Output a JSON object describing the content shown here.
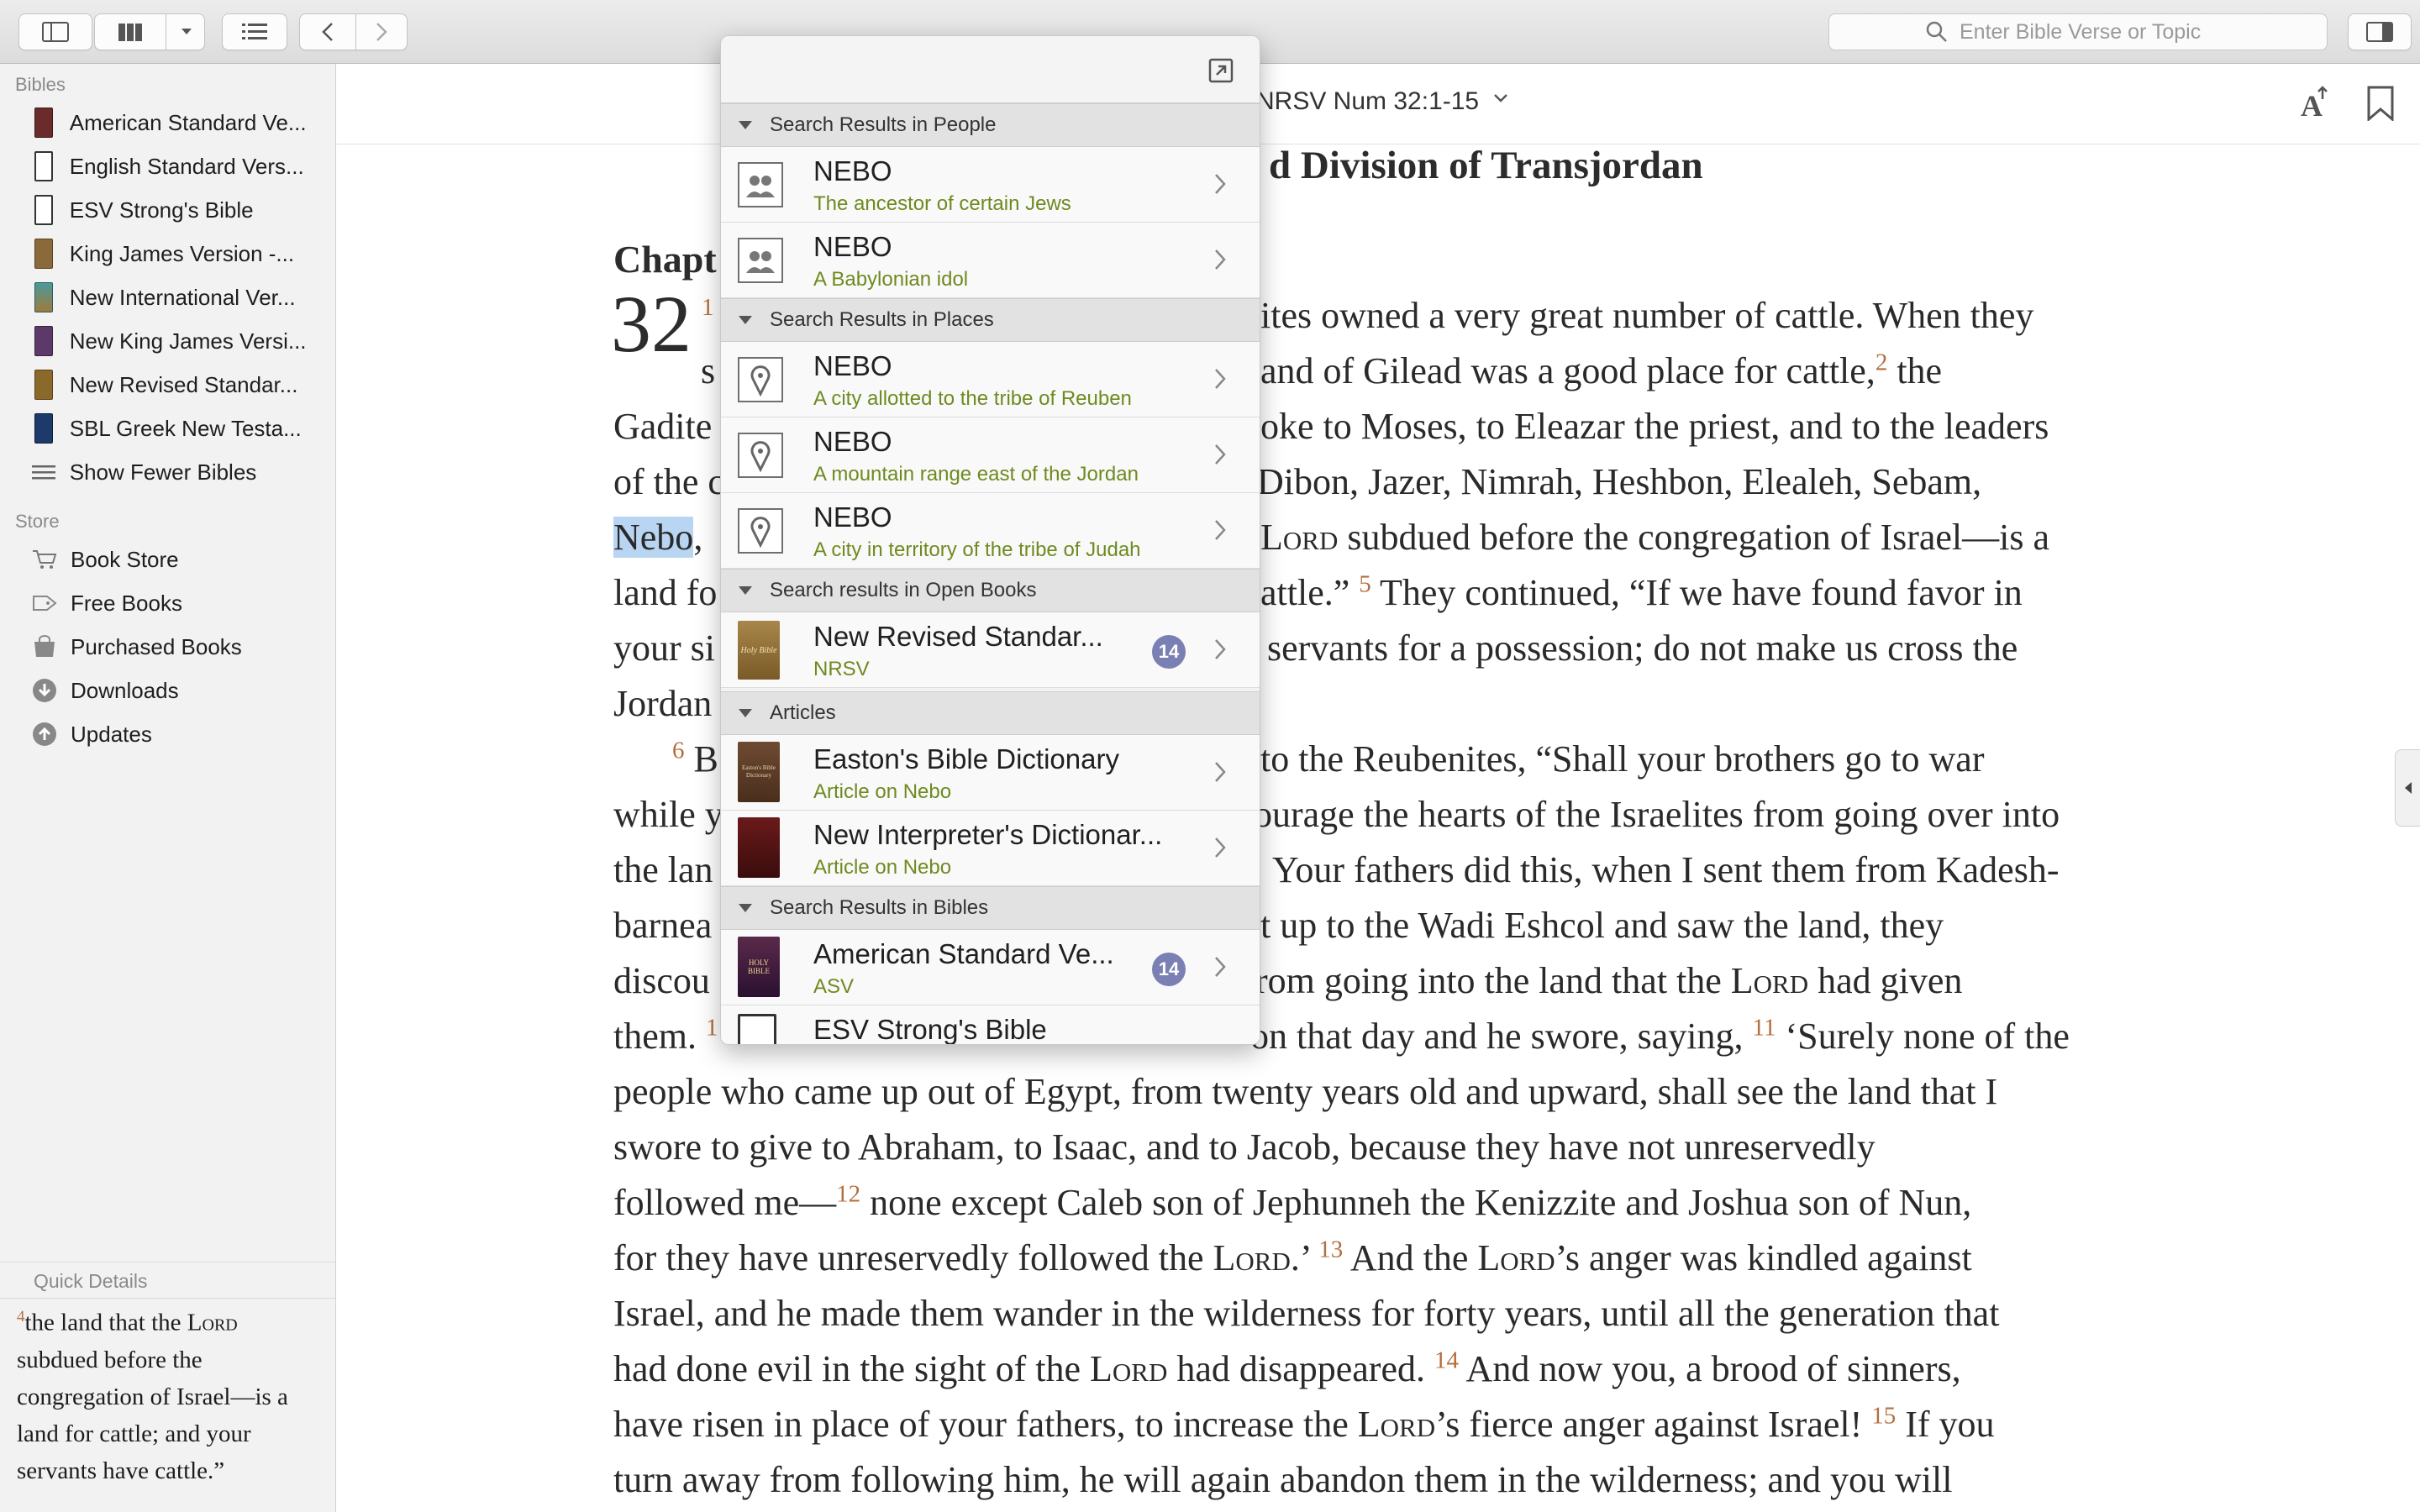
{
  "toolbar": {
    "search_placeholder": "Enter Bible Verse or Topic"
  },
  "sidebar": {
    "bibles_heading": "Bibles",
    "bibles": [
      {
        "label": "American Standard Ve...",
        "color": "#6b2b2b"
      },
      {
        "label": "English Standard Vers...",
        "color": "#ffffff"
      },
      {
        "label": "ESV Strong's Bible",
        "color": "#ffffff"
      },
      {
        "label": "King James Version -...",
        "color": "#8a6a3a"
      },
      {
        "label": "New International Ver...",
        "color": "#3a8a8a"
      },
      {
        "label": "New King James Versi...",
        "color": "#5b3a6a"
      },
      {
        "label": "New Revised Standar...",
        "color": "#8a6a2a"
      },
      {
        "label": "SBL Greek New Testa...",
        "color": "#1d3a6a"
      }
    ],
    "show_fewer": "Show Fewer Bibles",
    "store_heading": "Store",
    "store_items": [
      {
        "label": "Book Store",
        "icon": "cart-icon"
      },
      {
        "label": "Free Books",
        "icon": "tag-icon"
      },
      {
        "label": "Purchased Books",
        "icon": "purchased-icon"
      },
      {
        "label": "Downloads",
        "icon": "download-icon"
      },
      {
        "label": "Updates",
        "icon": "update-icon"
      }
    ],
    "quick_details_title": "Quick Details",
    "quick_details": {
      "verse_num": "4",
      "part1": "the land that the ",
      "lord": "Lord",
      "part2": " subdued before the congregation of Israel—is a land for cattle; and your servants have cattle.”"
    }
  },
  "content": {
    "reference": "NRSV Num 32:1-15",
    "section_title": "d Division of Transjordan",
    "chapter_word": "Chapt",
    "chapter_number": "32",
    "verse1_marker": "1",
    "lines": {
      "l1": "ites owned a very great number of cattle. When they",
      "l2a": "and of Gilead was a good place for cattle,",
      "v2": "2",
      "l2b": " the",
      "l2c": "s",
      "l3a": "Gadite",
      "l3b": "oke to Moses, to Eleazar the priest, and to the leaders",
      "l4a": "of the c",
      "l4b": "Dibon, Jazer, Nimrah, Heshbon, Elealeh, Sebam,",
      "l5_nebo": "Nebo",
      "l5_comma": ",",
      "l5b_lord": "Lord",
      "l5b": " subdued before the congregation of Israel—is a",
      "l6a": "land fo",
      "l6b": "attle.”",
      "v5": "5",
      "l6c": " They continued, “If we have found favor in",
      "l7a": "your si",
      "l7b": "servants for a possession; do not make us cross the",
      "l8a": "Jordan",
      "v6": "6",
      "l9a": " B",
      "l9b": "to the Reubenites, “Shall your brothers go to war",
      "l10a": "while y",
      "l10b": "ourage the hearts of the Israelites from going over into",
      "l11a": "the lan",
      "l11b": "Your fathers did this, when I sent them from Kadesh-",
      "l12a": "barnea",
      "l12b": "t up to the Wadi Eshcol and saw the land, they",
      "l13a": "discou",
      "l13b": "rom going into the land that the ",
      "l13b_lord": "Lord",
      "l13c": " had given",
      "l14a": "them.",
      "v10": "1",
      "l14b": "on that day and he swore, saying,",
      "v11": "11",
      "l14c": " ‘Surely none of the",
      "l15": "people who came up out of Egypt, from twenty years old and upward, shall see the land that I",
      "l16": "swore to give to Abraham, to Isaac, and to Jacob, because they have not unreservedly",
      "l17a": "followed me—",
      "v12": "12",
      "l17b": " none except Caleb son of Jephunneh the Kenizzite and Joshua son of Nun,",
      "l18a": "for they have unreservedly followed the ",
      "l18_lord": "Lord",
      "l18b": ".’",
      "v13": "13",
      "l18c": " And the ",
      "l18_lord2": "Lord",
      "l18d": "’s anger was kindled against",
      "l19": "Israel, and he made them wander in the wilderness for forty years, until all the generation that",
      "l20a": "had done evil in the sight of the ",
      "l20_lord": "Lord",
      "l20b": " had disappeared.",
      "v14": "14",
      "l20c": " And now you, a brood of sinners,",
      "l21a": "have risen in place of your fathers, to increase the ",
      "l21_lord": "Lord",
      "l21b": "’s fierce anger against Israel!",
      "v15": "15",
      "l21c": " If you",
      "l22": "turn away from following him, he will again abandon them in the wilderness; and you will"
    }
  },
  "popover": {
    "sections": {
      "people": "Search Results in People",
      "places": "Search Results in Places",
      "open_books": "Search results in Open Books",
      "articles": "Articles",
      "bibles": "Search Results in Bibles"
    },
    "rows": {
      "p1": {
        "title": "NEBO",
        "sub": "The ancestor of certain Jews"
      },
      "p2": {
        "title": "NEBO",
        "sub": "A Babylonian idol"
      },
      "pl1": {
        "title": "NEBO",
        "sub": "A city allotted to the tribe of Reuben"
      },
      "pl2": {
        "title": "NEBO",
        "sub": "A mountain range east of the Jordan"
      },
      "pl3": {
        "title": "NEBO",
        "sub": "A city in territory of the tribe of Judah"
      },
      "ob1": {
        "title": "New Revised Standar...",
        "sub": "NRSV",
        "badge": "14"
      },
      "a1": {
        "title": "Easton's Bible Dictionary",
        "sub": "Article on Nebo"
      },
      "a2": {
        "title": "New Interpreter's Dictionar...",
        "sub": "Article on Nebo"
      },
      "b1": {
        "title": "American Standard Ve...",
        "sub": "ASV",
        "badge": "14"
      },
      "b2": {
        "title": "ESV Strong's Bible"
      }
    },
    "cover_text": {
      "holy_bible": "Holy Bible",
      "eastons": "Easton's Bible Dictionary",
      "asv_holy": "HOLY BIBLE"
    },
    "badge_color": "#7a80b3",
    "subtitle_color": "#6e8a1f"
  },
  "colors": {
    "verse_number": "#b46f3e",
    "selection": "#b8d5f2"
  }
}
